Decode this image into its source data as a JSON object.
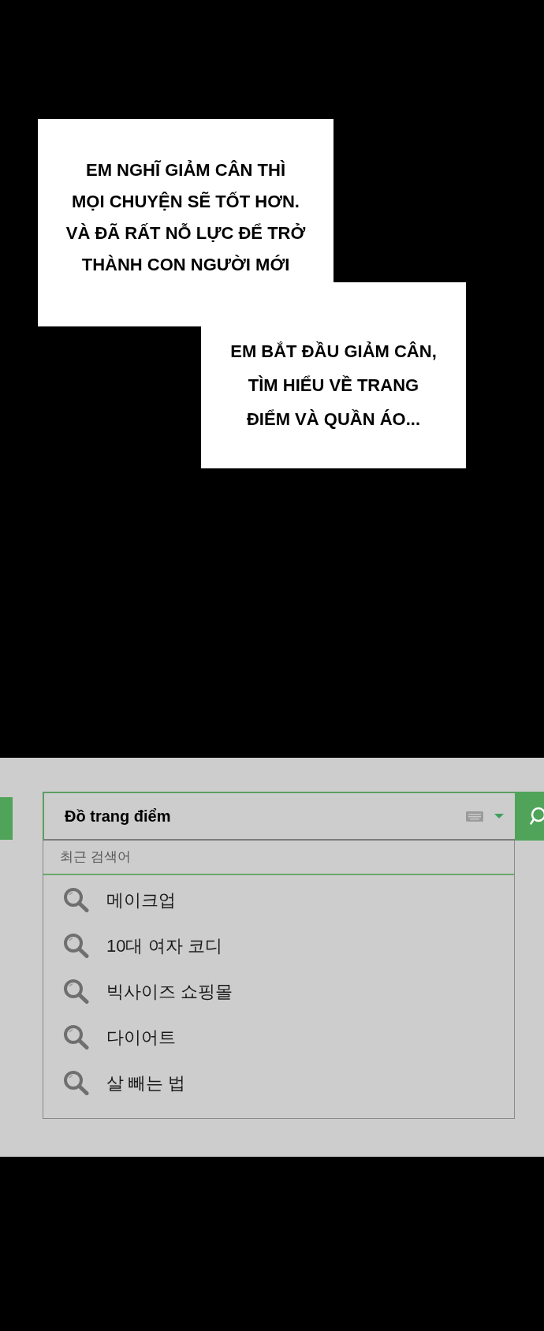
{
  "captions": [
    {
      "text": "EM NGHĨ GIẢM CÂN THÌ\nMỌI CHUYỆN SẼ TỐT HƠN.\nVÀ ĐÃ RẤT NỖ LỰC ĐỂ TRỞ\nTHÀNH CON NGƯỜI MỚI"
    },
    {
      "text": "EM BẮT ĐẦU GIẢM CÂN,\nTÌM HIỂU VỀ TRANG\nĐIỂM VÀ QUẦN ÁO..."
    }
  ],
  "search": {
    "value": "Đồ trang điểm",
    "recent_label": "최근 검색어",
    "recent": [
      "메이크업",
      "10대 여자 코디",
      "빅사이즈 쇼핑몰",
      "다이어트",
      "살 빼는 법"
    ]
  }
}
